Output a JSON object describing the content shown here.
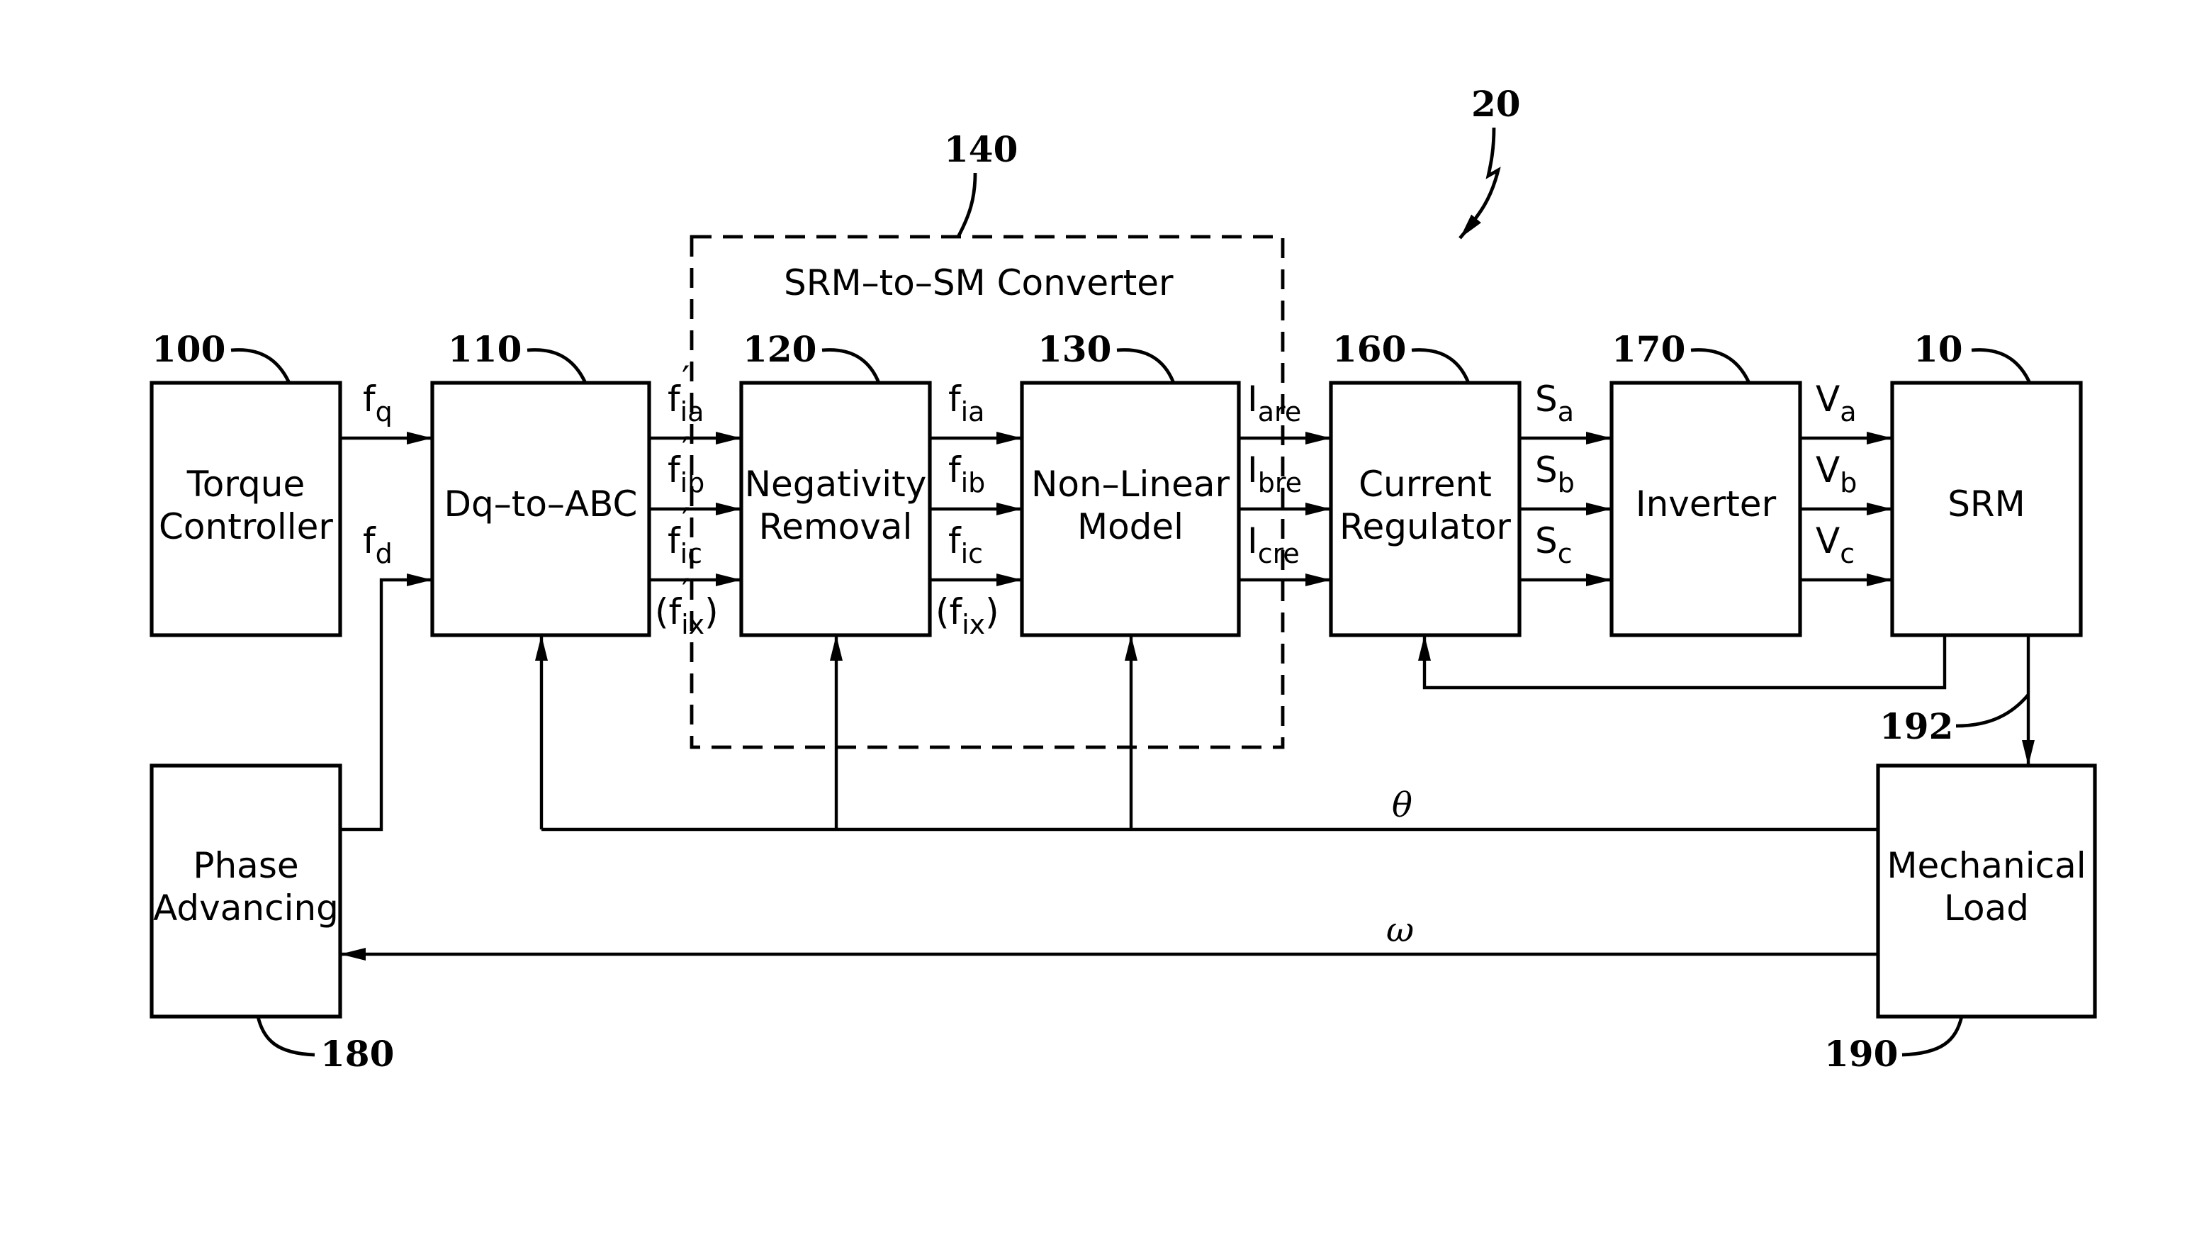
{
  "figure_ref": "20",
  "converter": {
    "ref": "140",
    "title": "SRM–to–SM  Converter"
  },
  "blocks": {
    "torque_controller": {
      "ref": "100",
      "line1": "Torque",
      "line2": "Controller"
    },
    "dq_to_abc": {
      "ref": "110",
      "line1": "Dq–to–ABC"
    },
    "negativity_removal": {
      "ref": "120",
      "line1": "Negativity",
      "line2": "Removal"
    },
    "non_linear_model": {
      "ref": "130",
      "line1": "Non–Linear",
      "line2": "Model"
    },
    "current_regulator": {
      "ref": "160",
      "line1": "Current",
      "line2": "Regulator"
    },
    "inverter": {
      "ref": "170",
      "line1": "Inverter"
    },
    "srm": {
      "ref": "10",
      "line1": "SRM"
    },
    "phase_advancing": {
      "ref": "180",
      "line1": "Phase",
      "line2": "Advancing"
    },
    "mechanical_load": {
      "ref": "190",
      "line1": "Mechanical",
      "line2": "Load"
    }
  },
  "shaft_ref": "192",
  "signals": {
    "fq": {
      "base": "f",
      "sub": "q"
    },
    "fd": {
      "base": "f",
      "sub": "d"
    },
    "fia_p": {
      "base": "f",
      "sub": "ia",
      "prime": "′"
    },
    "fib_p": {
      "base": "f",
      "sub": "ib",
      "prime": "′"
    },
    "fic_p": {
      "base": "f",
      "sub": "ic",
      "prime": "′"
    },
    "fix_p": {
      "open": "(f",
      "sub": "ix",
      "prime": "′",
      "close": ")"
    },
    "fia": {
      "base": "f",
      "sub": "ia"
    },
    "fib": {
      "base": "f",
      "sub": "ib"
    },
    "fic": {
      "base": "f",
      "sub": "ic"
    },
    "fix": {
      "open": "(f",
      "sub": "ix",
      "close": ")"
    },
    "iare": {
      "base": "I",
      "sub": "are"
    },
    "ibre": {
      "base": "I",
      "sub": "bre"
    },
    "icre": {
      "base": "I",
      "sub": "cre"
    },
    "sa": {
      "base": "S",
      "sub": "a"
    },
    "sb": {
      "base": "S",
      "sub": "b"
    },
    "sc": {
      "base": "S",
      "sub": "c"
    },
    "va": {
      "base": "V",
      "sub": "a"
    },
    "vb": {
      "base": "V",
      "sub": "b"
    },
    "vc": {
      "base": "V",
      "sub": "c"
    },
    "theta": "θ",
    "omega": "ω"
  }
}
